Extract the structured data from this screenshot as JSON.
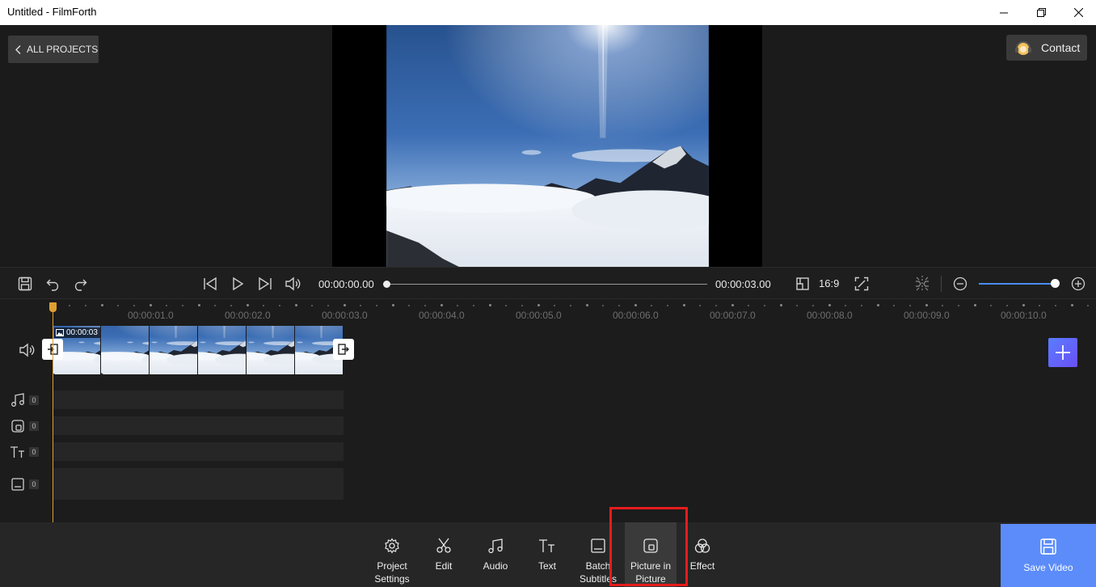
{
  "window": {
    "title": "Untitled - FilmForth"
  },
  "header": {
    "all_projects": "ALL PROJECTS",
    "contact": "Contact"
  },
  "player": {
    "current_time": "00:00:00.00",
    "total_time": "00:00:03.00",
    "aspect_ratio": "16:9",
    "progress": 0
  },
  "timeline": {
    "ruler_labels": [
      "00:00:01.0",
      "00:00:02.0",
      "00:00:03.0",
      "00:00:04.0",
      "00:00:05.0",
      "00:00:06.0",
      "00:00:07.0",
      "00:00:08.0",
      "00:00:09.0",
      "00:00:10.0"
    ],
    "clip_duration": "00:00:03",
    "track_counts": {
      "audio": "0",
      "pip": "0",
      "text": "0",
      "subtitle": "0"
    }
  },
  "toolbar": {
    "project_settings_1": "Project",
    "project_settings_2": "Settings",
    "edit": "Edit",
    "audio": "Audio",
    "text": "Text",
    "batch_1": "Batch",
    "batch_2": "Subtitles",
    "pip_1": "Picture in",
    "pip_2": "Picture",
    "effect": "Effect",
    "save": "Save Video"
  },
  "colors": {
    "accent": "#5c8cf9",
    "playhead": "#e0a030",
    "highlight": "#e51c1c"
  },
  "icons": [
    "save-icon",
    "undo-icon",
    "redo-icon",
    "skip-start-icon",
    "play-icon",
    "skip-end-icon",
    "volume-icon",
    "aspect-ratio-icon",
    "fullscreen-icon",
    "split-icon",
    "zoom-out-icon",
    "zoom-in-icon",
    "music-note-icon",
    "pip-icon",
    "text-icon",
    "subtitle-icon",
    "gear-icon",
    "scissors-icon",
    "effect-icon",
    "plus-icon"
  ]
}
